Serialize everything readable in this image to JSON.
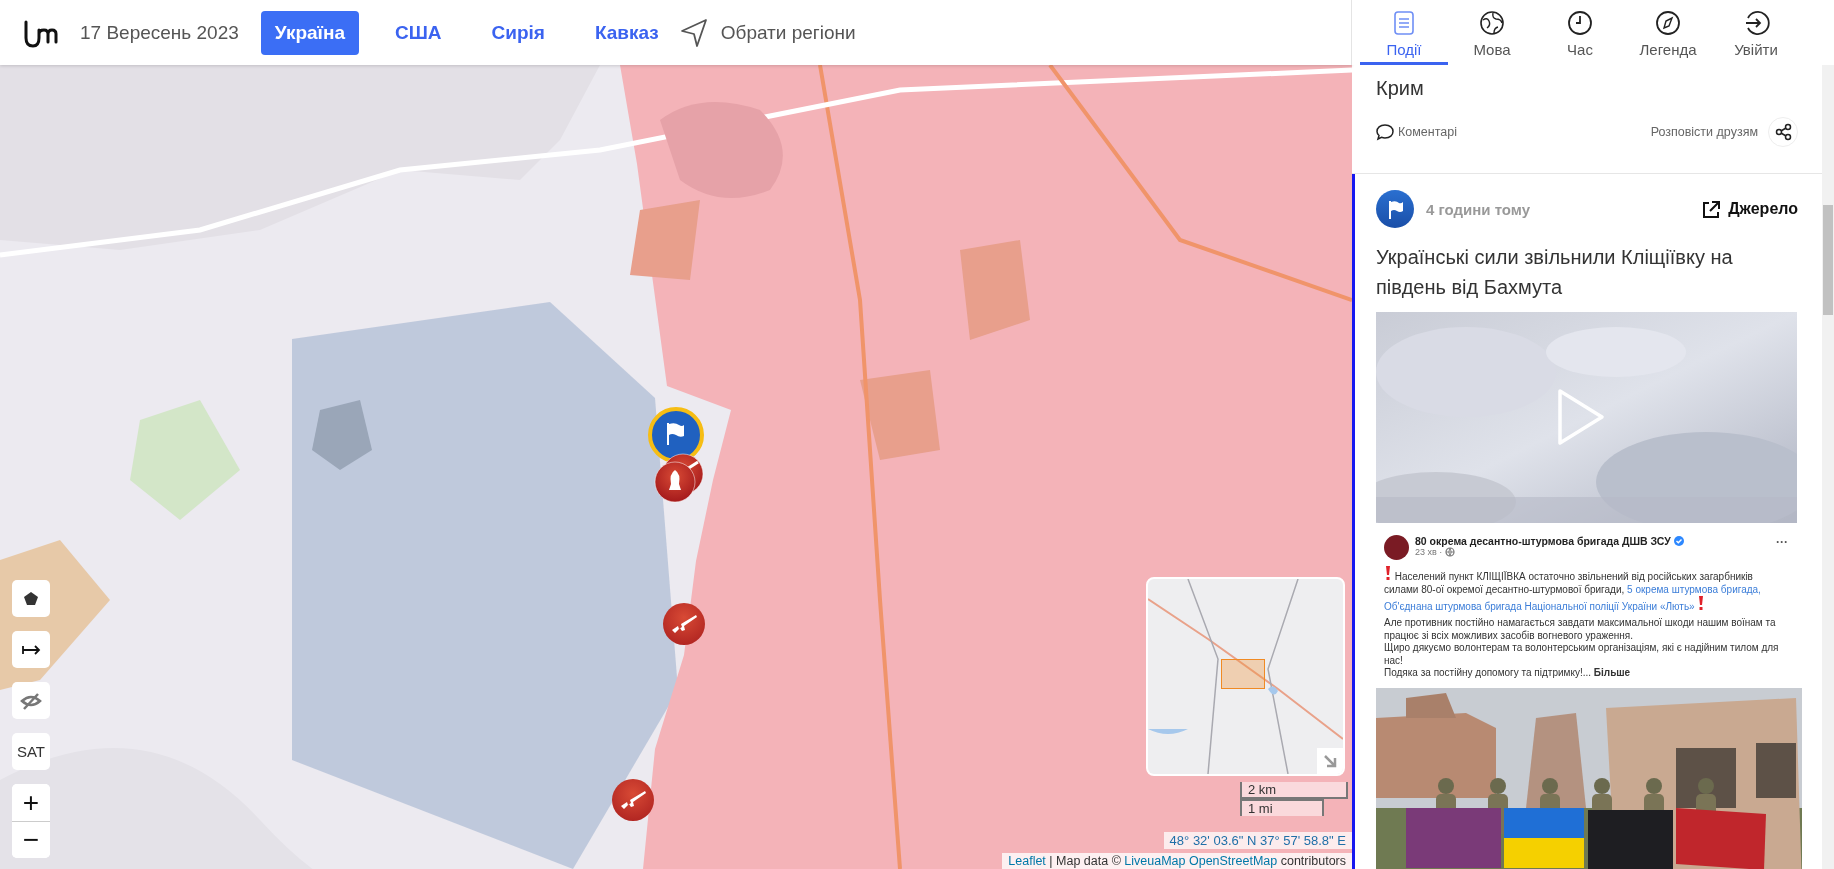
{
  "header": {
    "date": "17 Вересень 2023",
    "regions": [
      {
        "label": "Україна",
        "selected": true
      },
      {
        "label": "США",
        "selected": false
      },
      {
        "label": "Сирія",
        "selected": false
      },
      {
        "label": "Кавказ",
        "selected": false
      }
    ],
    "choose_regions": "Обрати регіони"
  },
  "nav": [
    {
      "label": "Події",
      "selected": true
    },
    {
      "label": "Мова",
      "selected": false
    },
    {
      "label": "Час",
      "selected": false
    },
    {
      "label": "Легенда",
      "selected": false
    },
    {
      "label": "Увійти",
      "selected": false
    }
  ],
  "map": {
    "kind": "picture",
    "markers": [
      {
        "kind": "flag"
      },
      {
        "kind": "cluster"
      },
      {
        "kind": "rifle"
      },
      {
        "kind": "rifle"
      }
    ],
    "controls": [
      {
        "kind": "polygon"
      },
      {
        "kind": "measure"
      },
      {
        "kind": "hide"
      },
      {
        "kind": "text",
        "label": "SAT"
      },
      {
        "kind": "text",
        "label": "+"
      },
      {
        "kind": "text",
        "label": "−"
      }
    ],
    "scale": [
      "2 km",
      "1 mi"
    ],
    "coordinates": "48° 32' 03.6\" N 37° 57' 58.8\" E",
    "attribution": {
      "leaflet": "Leaflet",
      "text": "| Map data ©",
      "links": [
        "LiveuaMap",
        "OpenStreetMap"
      ],
      "tail": "contributors"
    }
  },
  "feed": [
    {
      "title": "Крим",
      "comments": "Коментарі",
      "share": "Розповісти друзям"
    },
    {
      "time": "4 години тому",
      "source": "Джерело",
      "title": "Українські сили звільнили Кліщіївку на південь від Бахмута",
      "video": {
        "kind": "picture"
      },
      "post": {
        "author": "80 окрема десантно-штурмова бригада ДШВ ЗСУ",
        "verified": true,
        "time": "23 хв ·",
        "more": "···",
        "text": "Населений пункт КЛІЩІЇВКА остаточно звільнений від російських загарбників силами 80-ої окремої десантно-штурмової бригади,",
        "links": [
          "5 окрема штурмова бригада,",
          "Об'єднана штурмова бригада Національної поліції України «Лють»"
        ],
        "lines": [
          "Але противник постійно намагається завдати максимальної шкоди нашим воїнам та працює зі всіх можливих засобів вогневого ураження.",
          "Щиро дякуємо волонтерам та волонтерським організаціям, які є надійним тилом для нас!",
          "Подяка за постійну допомогу та підтримку!... **Більше**"
        ],
        "photo": {
          "kind": "picture"
        }
      }
    }
  ]
}
